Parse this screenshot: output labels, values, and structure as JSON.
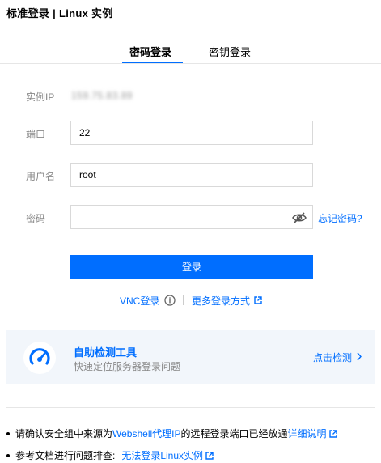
{
  "page": {
    "title": "标准登录 | Linux 实例"
  },
  "tabs": [
    {
      "label": "密码登录",
      "active": true
    },
    {
      "label": "密钥登录",
      "active": false
    }
  ],
  "form": {
    "ip_label": "实例IP",
    "ip_value": "159.75.83.89",
    "port_label": "端口",
    "port_value": "22",
    "user_label": "用户名",
    "user_value": "root",
    "password_label": "密码",
    "password_value": "",
    "forgot_label": "忘记密码?"
  },
  "login_button": "登录",
  "alt_login": {
    "vnc_label": "VNC登录",
    "more_label": "更多登录方式"
  },
  "tool": {
    "title": "自助检测工具",
    "subtitle": "快速定位服务器登录问题",
    "link": "点击检测"
  },
  "notes": {
    "note1_prefix": "请确认安全组中来源为",
    "note1_link1": "Webshell代理IP",
    "note1_mid": "的远程登录端口已经放通",
    "note1_link2": "详细说明",
    "note2_prefix": "参考文档进行问题排查:",
    "note2_link": "无法登录Linux实例"
  },
  "colors": {
    "accent": "#006eff",
    "card_bg": "#f2f6fb",
    "label": "#888888"
  },
  "icons": [
    "eye-off-icon",
    "info-icon",
    "external-link-icon",
    "gauge-icon",
    "chevron-right-icon"
  ]
}
